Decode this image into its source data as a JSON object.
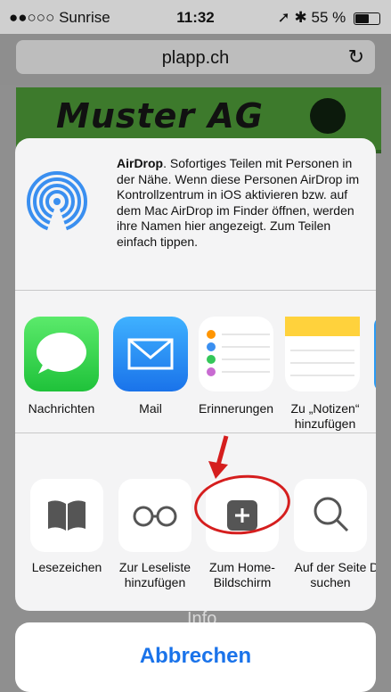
{
  "status": {
    "carrier": "●●○○○ Sunrise",
    "time": "11:32",
    "battery": "55 %",
    "battery_level": 0.55
  },
  "browser": {
    "url": "plapp.ch"
  },
  "page": {
    "banner_title": "Muster AG",
    "footer_text": "Info"
  },
  "airdrop": {
    "title": "AirDrop",
    "text": ". Sofortiges Teilen mit Personen in der Nähe. Wenn diese Personen AirDrop im Kontrollzentrum in iOS aktivieren bzw. auf dem Mac AirDrop im Finder öffnen, werden ihre Namen hier angezeigt. Zum Teilen einfach tippen."
  },
  "apps": [
    {
      "label": "Nachrichten",
      "icon": "messages-icon"
    },
    {
      "label": "Mail",
      "icon": "mail-icon"
    },
    {
      "label": "Erinnerungen",
      "icon": "reminders-icon"
    },
    {
      "label": "Zu „Notizen“ hinzufügen",
      "icon": "notes-icon"
    }
  ],
  "actions": [
    {
      "label": "Lesezeichen",
      "icon": "book-icon"
    },
    {
      "label": "Zur Leseliste hinzufügen",
      "icon": "glasses-icon"
    },
    {
      "label": "Zum Home-Bildschirm",
      "icon": "plus-icon"
    },
    {
      "label": "Auf der Seite suchen",
      "icon": "search-icon"
    },
    {
      "label": "D",
      "icon": ""
    }
  ],
  "cancel": {
    "label": "Abbrechen"
  },
  "colors": {
    "accent": "#1a73ea",
    "annotation": "#d51e1e"
  }
}
